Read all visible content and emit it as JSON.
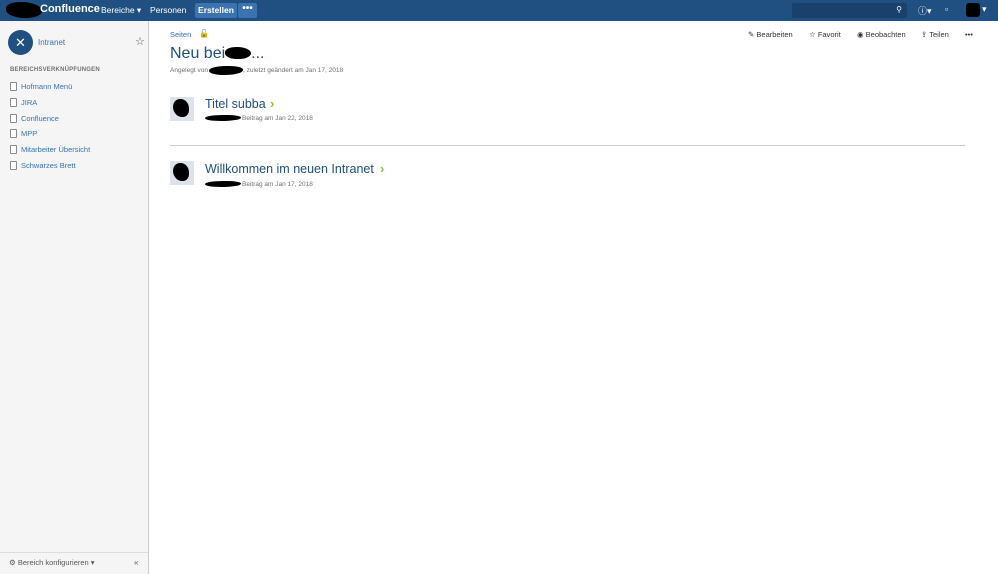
{
  "header": {
    "logo_text": "Confluence",
    "nav": [
      "Bereiche ▾",
      "Personen"
    ],
    "create_label": "Erstellen",
    "more_label": "•••",
    "search_placeholder": "",
    "icons": [
      "search-icon",
      "help-icon",
      "notifications-icon"
    ],
    "accent": "#205081"
  },
  "sidebar": {
    "space_name": "Intranet",
    "section_title": "BEREICHSVERKNÜPFUNGEN",
    "links": [
      "Hofmann Menü",
      "JIRA",
      "Confluence",
      "MPP",
      "Mitarbeiter Übersicht",
      "Schwarzes Brett"
    ],
    "configure_label": "Bereich konfigurieren ▾",
    "collapse_label": "«"
  },
  "page": {
    "breadcrumb": "Seiten",
    "actions": [
      "Bearbeiten",
      "Favorit",
      "Beobachten",
      "Teilen",
      "•••"
    ],
    "title": "Neu bei",
    "title_suffix": "...",
    "meta_prefix": "Angelegt von",
    "meta_suffix": ", zuletzt geändert am Jan 17, 2018"
  },
  "posts": [
    {
      "title": "Titel subba",
      "meta": "Beitrag am Jan 22, 2018"
    },
    {
      "title": "Willkommen im neuen Intranet",
      "meta": "Beitrag am Jan 17, 2018"
    }
  ]
}
